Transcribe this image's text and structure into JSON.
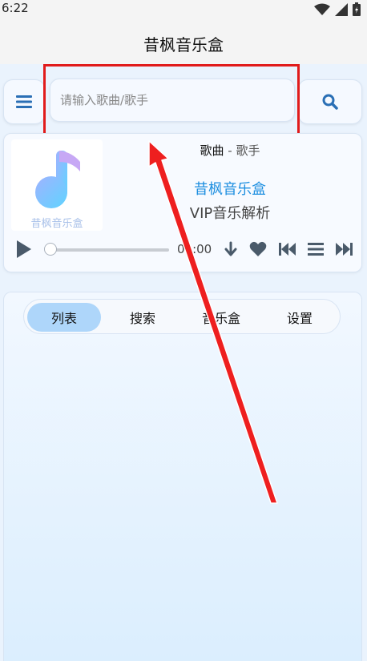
{
  "status_bar": {
    "time": "6:22"
  },
  "app": {
    "title": "昔枫音乐盒"
  },
  "search": {
    "placeholder": "请输入歌曲/歌手"
  },
  "player": {
    "song": "歌曲",
    "separator": "-",
    "artist": "歌手",
    "brand": "昔枫音乐盒",
    "subtitle": "VIP音乐解析",
    "cover_text": "昔枫音乐盒",
    "current_time": "00:00",
    "progress": 0
  },
  "tabs": [
    {
      "label": "列表",
      "active": true
    },
    {
      "label": "搜索",
      "active": false
    },
    {
      "label": "音乐盒",
      "active": false
    },
    {
      "label": "设置",
      "active": false
    }
  ],
  "icons": {
    "menu": "menu-icon",
    "search": "search-icon",
    "play": "play-icon",
    "download": "download-icon",
    "favorite": "heart-icon",
    "previous": "skip-back-icon",
    "playlist": "list-icon",
    "next": "skip-forward-icon"
  },
  "colors": {
    "accent": "#1e8fe0",
    "highlight": "#e11b1b",
    "active_tab": "#aed6fa",
    "icon": "#4a5a6a"
  }
}
